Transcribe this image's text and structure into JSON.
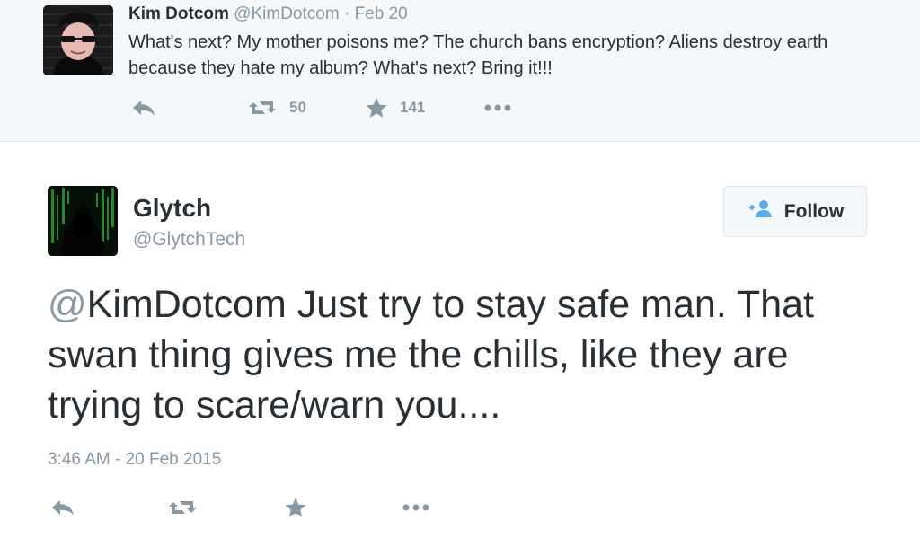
{
  "parent_tweet": {
    "name": "Kim Dotcom",
    "handle": "@KimDotcom",
    "separator": "·",
    "date": "Feb 20",
    "text": "What's next? My mother poisons me? The church bans encryption? Aliens destroy earth because they hate my album? What's next? Bring it!!!",
    "actions": {
      "reply_icon": "reply-icon",
      "retweet_icon": "retweet-icon",
      "retweet_count": "50",
      "favorite_icon": "star-icon",
      "favorite_count": "141",
      "more_icon": "more-dots-icon"
    }
  },
  "main_tweet": {
    "name": "Glytch",
    "handle": "@GlytchTech",
    "follow_label": "Follow",
    "mention_at": "@",
    "mention_name": "KimDotcom",
    "text_rest": " Just try to stay safe man. That swan thing gives me the chills, like they are trying to scare/warn you....",
    "timestamp": "3:46 AM - 20 Feb 2015",
    "actions": {
      "reply_icon": "reply-icon",
      "retweet_icon": "retweet-icon",
      "favorite_icon": "star-icon",
      "more_icon": "more-dots-icon"
    }
  },
  "colors": {
    "muted": "#8899a6",
    "text": "#292f33",
    "follow_icon": "#55acee",
    "background_parent": "#f5f8fa"
  }
}
